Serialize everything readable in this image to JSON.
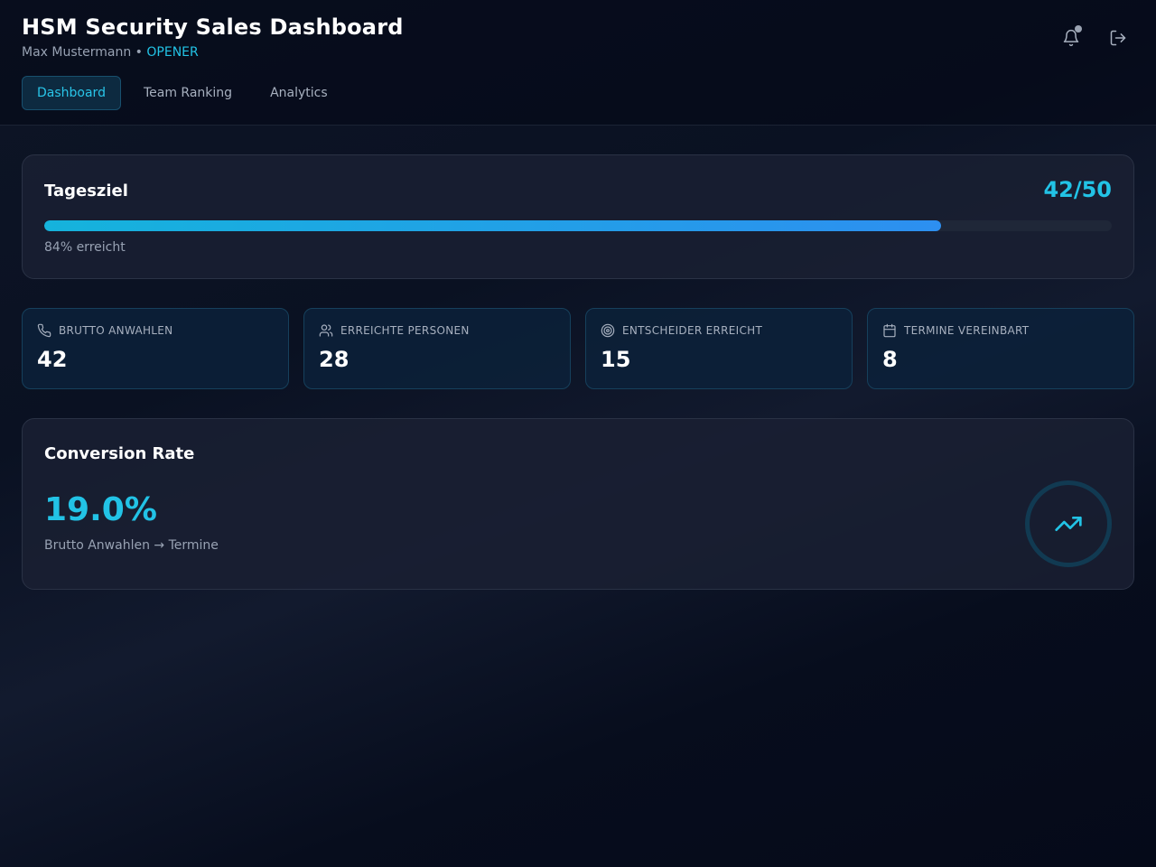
{
  "header": {
    "title": "HSM Security Sales Dashboard",
    "user_name": "Max Mustermann",
    "separator": " • ",
    "user_role": "OPENER",
    "icons": {
      "notifications": "bell-icon",
      "logout": "logout-icon"
    }
  },
  "tabs": [
    {
      "label": "Dashboard",
      "active": true
    },
    {
      "label": "Team Ranking",
      "active": false
    },
    {
      "label": "Analytics",
      "active": false
    }
  ],
  "goal": {
    "title": "Tagesziel",
    "value_text": "42/50",
    "progress_fraction": 0.84,
    "caption": "84% erreicht"
  },
  "stats": [
    {
      "icon": "phone-icon",
      "label": "BRUTTO ANWAHLEN",
      "value": "42"
    },
    {
      "icon": "users-icon",
      "label": "ERREICHTE PERSONEN",
      "value": "28"
    },
    {
      "icon": "target-icon",
      "label": "ENTSCHEIDER ERREICHT",
      "value": "15"
    },
    {
      "icon": "calendar-icon",
      "label": "TERMINE VEREINBART",
      "value": "8"
    }
  ],
  "conversion": {
    "title": "Conversion Rate",
    "value": "19.0%",
    "caption": "Brutto Anwahlen → Termine",
    "icon": "trending-up-icon"
  },
  "colors": {
    "accent": "#22c3e6",
    "progress_start": "#15b3dc",
    "progress_end": "#2d8ff0",
    "tab_active_bg": "#0d2a40"
  }
}
